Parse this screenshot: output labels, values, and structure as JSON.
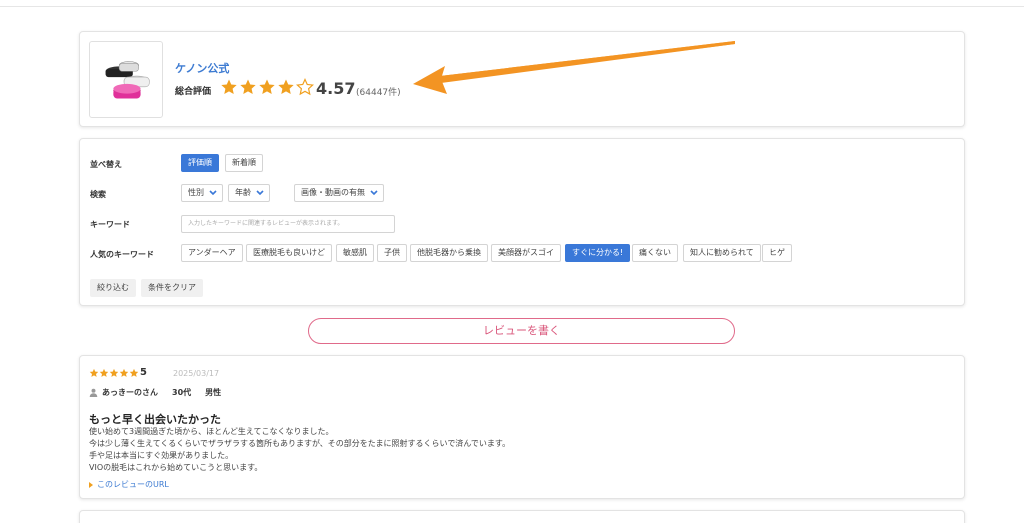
{
  "colors": {
    "accent_blue": "#3a78d8",
    "star_gold": "#f0a020",
    "arrow_orange": "#f39423",
    "pink": "#d9557a"
  },
  "header": {
    "brand": "ケノン公式",
    "rating_label": "総合評価",
    "score": "4.57",
    "count": "(64447件)",
    "stars": 4.57
  },
  "filters": {
    "sort_label": "並べ替え",
    "sort_options": [
      "評価順",
      "新着順"
    ],
    "search_label": "検索",
    "search_selects": [
      "性別",
      "年齢",
      "画像・動画の有無"
    ],
    "keyword_label": "キーワード",
    "keyword_placeholder": "入力したキーワードに関連するレビューが表示されます。",
    "popular_label": "人気のキーワード",
    "popular_keywords": [
      "アンダーヘア",
      "医療脱毛も良いけど",
      "敏感肌",
      "子供",
      "他脱毛器から乗換",
      "美顔器がスゴイ",
      "すぐに分かる!",
      "痛くない",
      "知人に勧められて",
      "ヒゲ"
    ],
    "active_keyword": "すぐに分かる!",
    "narrow_button": "絞り込む",
    "clear_button": "条件をクリア"
  },
  "write_review": "レビューを書く",
  "review": {
    "score": "5",
    "date": "2025/03/17",
    "author": "あっきーのさん",
    "age": "30代",
    "gender": "男性",
    "title": "もっと早く出会いたかった",
    "body": [
      "使い始めて3週間過ぎた頃から、ほとんど生えてこなくなりました。",
      "今は少し薄く生えてくるくらいでザラザラする箇所もありますが、その部分をたまに照射するくらいで済んでいます。",
      "手や足は本当にすぐ効果がありました。",
      "VIOの脱毛はこれから始めていこうと思います。"
    ],
    "link": "このレビューのURL"
  }
}
